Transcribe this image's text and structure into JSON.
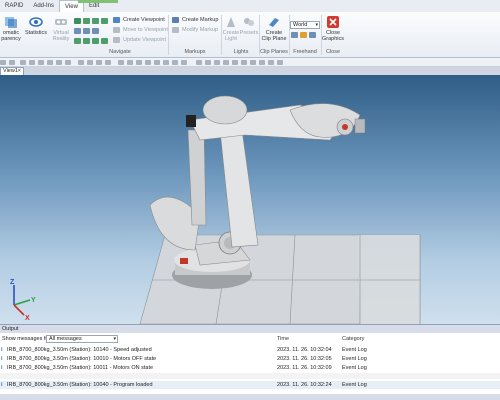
{
  "menu": {
    "tabs": [
      "RAPID",
      "Add-Ins",
      "View",
      "Edit"
    ],
    "active_tab": "View"
  },
  "ribbon": {
    "automatic_transparency": "omatic\nparency",
    "statistics": "Statistics",
    "virtual_reality": "Virtual\nReality",
    "create_viewpoint": "Create Viewpoint",
    "move_to_viewpoint": "Move to Viewpoint",
    "update_viewpoint": "Update Viewpoint",
    "navigate_label": "Navigate",
    "create_markup": "Create Markup",
    "modify_markup": "Modify Markup",
    "markups_label": "Markups",
    "create_light": "Create\nLight",
    "presets": "Presets",
    "lights_label": "Lights",
    "create_clip_plane": "Create\nClip Plane",
    "clip_planes_label": "Clip Planes",
    "world_combo": "World",
    "freehand_label": "Freehand",
    "close_graphics": "Close\nGraphics",
    "close_label": "Close"
  },
  "view_tab": {
    "title": "View1",
    "close": "×"
  },
  "output": {
    "title": "Output",
    "filter_label": "Show messages from:",
    "filter_value": "All messages",
    "col_time": "Time",
    "col_category": "Category",
    "rows": [
      {
        "msg": "IRB_8700_800kg_3.50m (Station): 10140 - Speed adjusted",
        "time": "2023. 11. 26. 10:32:04",
        "cat": "Event Log"
      },
      {
        "msg": "IRB_8700_800kg_3.50m (Station): 10010 - Motors OFF state",
        "time": "2023. 11. 26. 10:32:05",
        "cat": "Event Log"
      },
      {
        "msg": "IRB_8700_800kg_3.50m (Station): 10011 - Motors ON state",
        "time": "2023. 11. 26. 10:32:09",
        "cat": "Event Log"
      },
      {
        "msg": "IRB_8700_800kg_3.50m (Station): 10040 - Program loaded",
        "time": "2023. 11. 26. 10:32:24",
        "cat": "Event Log"
      }
    ]
  },
  "axes": {
    "x": "X",
    "y": "Y",
    "z": "Z"
  },
  "colors": {
    "ribbon_bg": "#e8edf4",
    "view_sky_top": "#2f5d86",
    "view_sky_bottom": "#cfe0ee",
    "robot": "#d9d9d9"
  }
}
